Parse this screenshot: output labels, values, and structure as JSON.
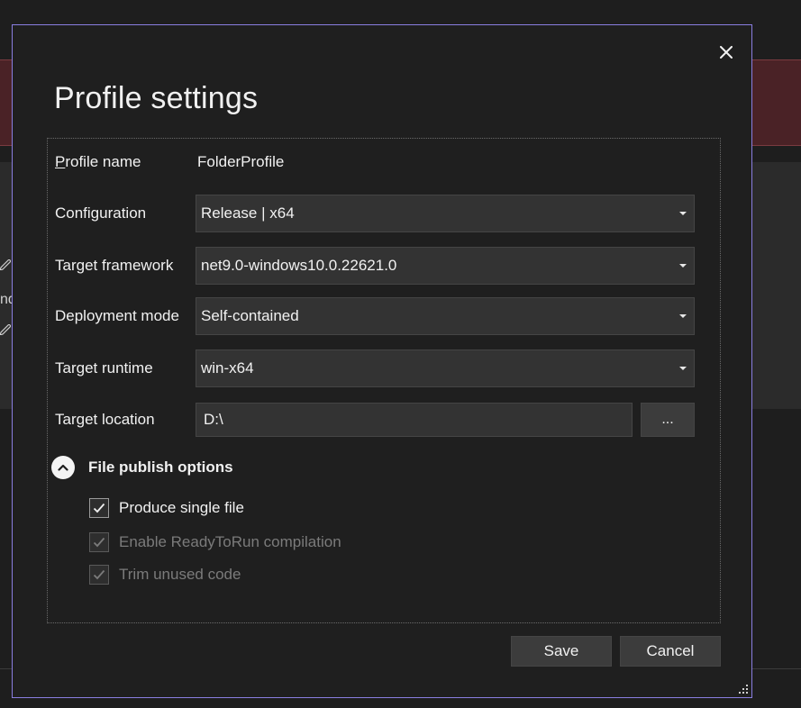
{
  "background": {
    "fragment_text": "nd"
  },
  "dialog": {
    "title": "Profile settings",
    "close_label": "✕"
  },
  "form": {
    "profile_name": {
      "label_prefix": "P",
      "label_rest": "rofile name",
      "value": "FolderProfile"
    },
    "configuration": {
      "label": "Configuration",
      "value": "Release | x64"
    },
    "target_framework": {
      "label": "Target framework",
      "value": "net9.0-windows10.0.22621.0"
    },
    "deployment_mode": {
      "label": "Deployment mode",
      "value": "Self-contained"
    },
    "target_runtime": {
      "label": "Target runtime",
      "value": "win-x64"
    },
    "target_location": {
      "label": "Target location",
      "value": "D:\\",
      "browse_label": "..."
    }
  },
  "publish_options": {
    "title": "File publish options",
    "options": [
      {
        "label": "Produce single file",
        "checked": true,
        "enabled": true
      },
      {
        "label": "Enable ReadyToRun compilation",
        "checked": true,
        "enabled": false
      },
      {
        "label": "Trim unused code",
        "checked": true,
        "enabled": false
      }
    ]
  },
  "buttons": {
    "save": "Save",
    "cancel": "Cancel"
  },
  "colors": {
    "dialog_border": "#8a7ee0",
    "banner": "#4a2226",
    "field_bg": "#333333"
  }
}
